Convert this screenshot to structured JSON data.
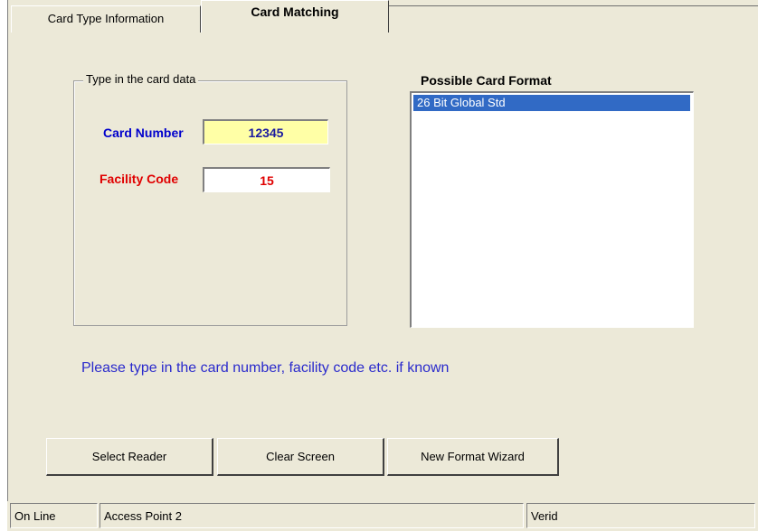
{
  "tabs": [
    {
      "label": "Card Type Information"
    },
    {
      "label": "Card Matching"
    }
  ],
  "group": {
    "legend": "Type in the card data",
    "card_number_label": "Card Number",
    "card_number_value": "12345",
    "facility_code_label": "Facility Code",
    "facility_code_value": "15"
  },
  "formats": {
    "heading": "Possible Card Format",
    "items": [
      "26 Bit Global Std"
    ]
  },
  "hint": "Please type in the card number, facility code etc. if known",
  "buttons": {
    "select_reader": "Select Reader",
    "clear_screen": "Clear Screen",
    "new_format_wizard": "New Format Wizard"
  },
  "status": {
    "connection": "On Line",
    "access_point": "Access Point 2",
    "user": "Verid"
  },
  "colors": {
    "card_number": "#0000cc",
    "facility_code": "#e00000",
    "selection": "#316ac5",
    "hint": "#2a2acc"
  }
}
